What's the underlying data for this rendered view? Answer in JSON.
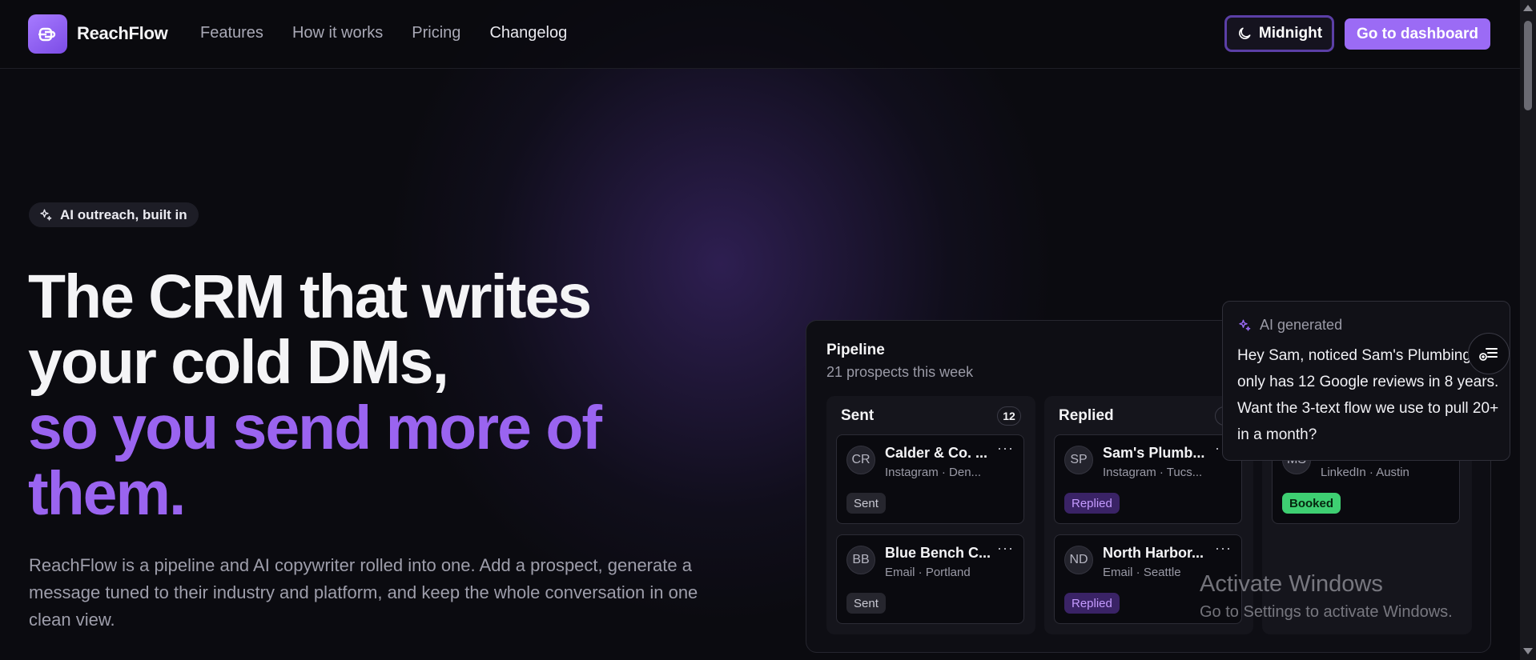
{
  "brand": {
    "name": "ReachFlow",
    "logo_icon": "logo-mark-icon",
    "accent": "#9b6bf5"
  },
  "nav": {
    "links": [
      {
        "label": "Features"
      },
      {
        "label": "How it works"
      },
      {
        "label": "Pricing"
      },
      {
        "label": "Changelog"
      }
    ],
    "theme_toggle": {
      "label": "Midnight",
      "icon": "moon-icon"
    },
    "cta": {
      "label": "Go to dashboard"
    }
  },
  "hero": {
    "pill": {
      "label": "AI outreach, built in",
      "icon": "sparkles-icon"
    },
    "headline": {
      "line1": "The CRM that writes",
      "line2": "your cold DMs,",
      "line3": "so you send more of",
      "line4": "them."
    },
    "description": "ReachFlow is a pipeline and AI copywriter rolled into one. Add a prospect, generate a message tuned to their industry and platform, and keep the whole conversation in one clean view."
  },
  "pipeline": {
    "title": "Pipeline",
    "subtitle": "21 prospects this week",
    "columns": [
      {
        "name": "Sent",
        "count": "12",
        "cards": [
          {
            "initials": "CR",
            "name": "Calder & Co. ...",
            "meta": "Instagram · Den...",
            "status": "Sent"
          },
          {
            "initials": "BB",
            "name": "Blue Bench C...",
            "meta": "Email · Portland",
            "status": "Sent"
          }
        ]
      },
      {
        "name": "Replied",
        "count": "",
        "cards": [
          {
            "initials": "SP",
            "name": "Sam's Plumb...",
            "meta": "Instagram · Tucs...",
            "status": "Replied"
          },
          {
            "initials": "ND",
            "name": "North Harbor...",
            "meta": "Email · Seattle",
            "status": "Replied"
          }
        ]
      },
      {
        "name": "",
        "count": "",
        "cards": [
          {
            "initials": "MS",
            "name": "",
            "meta": "LinkedIn · Austin",
            "status": "Booked"
          }
        ]
      }
    ]
  },
  "ai_popup": {
    "label": "AI generated",
    "message": "Hey Sam, noticed Sam's Plumbing only has 12 Google reviews in 8 years. Want the 3-text flow we use to pull 20+ in a month?",
    "action_icon": "add-notes-icon"
  },
  "os_watermark": {
    "title": "Activate Windows",
    "subtitle": "Go to Settings to activate Windows."
  }
}
